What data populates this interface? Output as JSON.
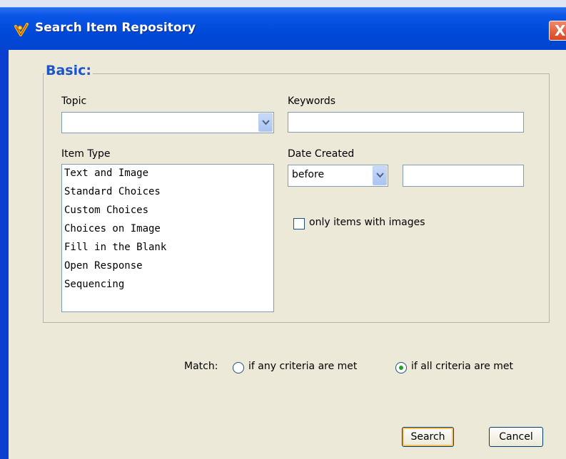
{
  "window": {
    "title": "Search Item Repository",
    "close_glyph": "X"
  },
  "basic": {
    "legend": "Basic:",
    "topic": {
      "label": "Topic",
      "value": ""
    },
    "keywords": {
      "label": "Keywords",
      "value": ""
    },
    "item_type": {
      "label": "Item Type",
      "options": [
        "Text and Image",
        "Standard Choices",
        "Custom Choices",
        "Choices on Image",
        "Fill in the Blank",
        "Open Response",
        "Sequencing"
      ]
    },
    "date_created": {
      "label": "Date Created",
      "operator": "before",
      "value": ""
    },
    "only_images": {
      "label": "only items with images",
      "checked": false
    }
  },
  "match": {
    "label": "Match:",
    "any_label": "if any criteria are met",
    "all_label": "if all criteria are met",
    "selected": "all"
  },
  "buttons": {
    "search": "Search",
    "cancel": "Cancel"
  },
  "colors": {
    "title_bar": "#0048d8",
    "legend": "#1d54c8",
    "dialog_bg": "#ece9d8",
    "radio_selected": "#21a121"
  }
}
